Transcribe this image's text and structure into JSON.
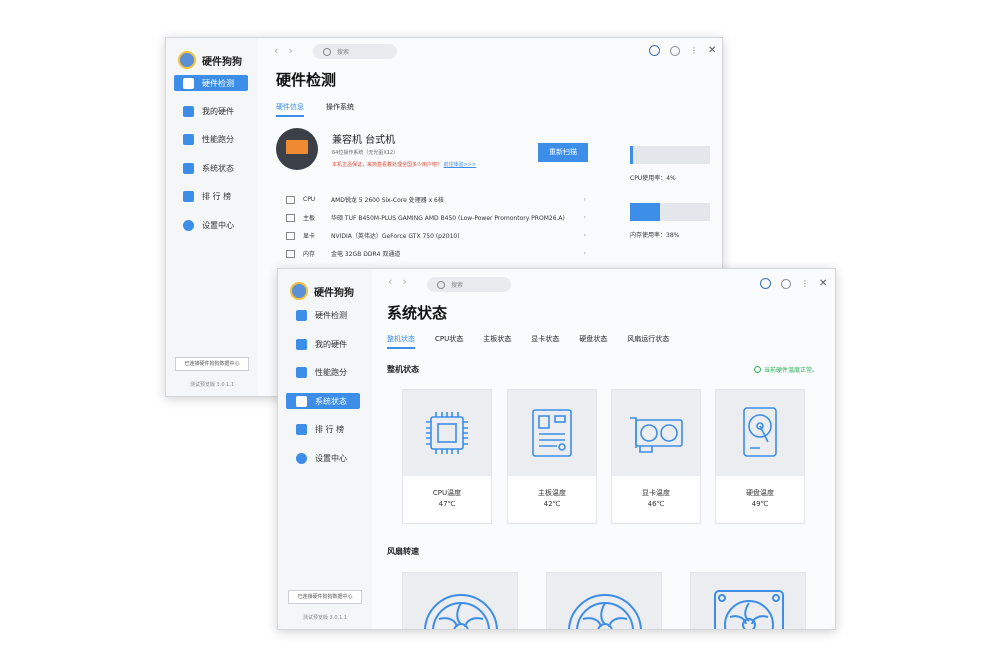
{
  "back": {
    "logo": "硬件狗狗",
    "nav": [
      "硬件检测",
      "我的硬件",
      "性能跑分",
      "系统状态",
      "排 行 榜",
      "设置中心"
    ],
    "search_placeholder": "搜索",
    "footer_btn": "已连接硬件狗狗数据中心",
    "version": "测试预览版 3.0.1.1",
    "title": "硬件检测",
    "tabs": [
      "硬件信息",
      "操作系统"
    ],
    "device": {
      "name": "兼容机 台式机",
      "os": "64位操作系统（无光驱X12）",
      "warning": "本机正品保证，来简直看着处理全国多少用户吧！",
      "warning_link": "前往体验>>>",
      "rescan": "重新扫描"
    },
    "hardware": [
      {
        "key": "CPU",
        "value": "AMD锐龙 5 2600 Six-Core 处理器 x 6核"
      },
      {
        "key": "主板",
        "value": "华硕 TUF B450M-PLUS GAMING AMD B450 (Low-Power Promontory PROM26.A)"
      },
      {
        "key": "显卡",
        "value": "NVIDIA（英伟达）GeForce GTX 750 (p2010)"
      },
      {
        "key": "内存",
        "value": "金电 32GB DDR4 双通道"
      }
    ],
    "usage": [
      {
        "label": "CPU使用率：",
        "value": "4%",
        "fraction": 0.04
      },
      {
        "label": "内存使用率：",
        "value": "38%",
        "fraction": 0.38
      }
    ]
  },
  "front": {
    "logo": "硬件狗狗",
    "nav": [
      "硬件检测",
      "我的硬件",
      "性能跑分",
      "系统状态",
      "排 行 榜",
      "设置中心"
    ],
    "active_nav": 3,
    "search_placeholder": "搜索",
    "footer_btn": "已连接硬件狗狗数据中心",
    "version": "测试预览版 3.0.1.1",
    "title": "系统状态",
    "tabs": [
      "整机状态",
      "CPU状态",
      "主板状态",
      "显卡状态",
      "硬盘状态",
      "风扇运行状态"
    ],
    "section1": "整机状态",
    "status_ok": "当前硬件温度正常。",
    "cards": [
      {
        "name": "CPU温度",
        "value": "47℃",
        "icon": "cpu-chip-icon"
      },
      {
        "name": "主板温度",
        "value": "42℃",
        "icon": "motherboard-icon"
      },
      {
        "name": "显卡温度",
        "value": "46℃",
        "icon": "graphics-card-icon"
      },
      {
        "name": "硬盘温度",
        "value": "49℃",
        "icon": "hard-disk-icon"
      }
    ],
    "section2": "风扇转速"
  },
  "colors": {
    "accent": "#3c8ee8",
    "ok": "#2fae5c"
  }
}
